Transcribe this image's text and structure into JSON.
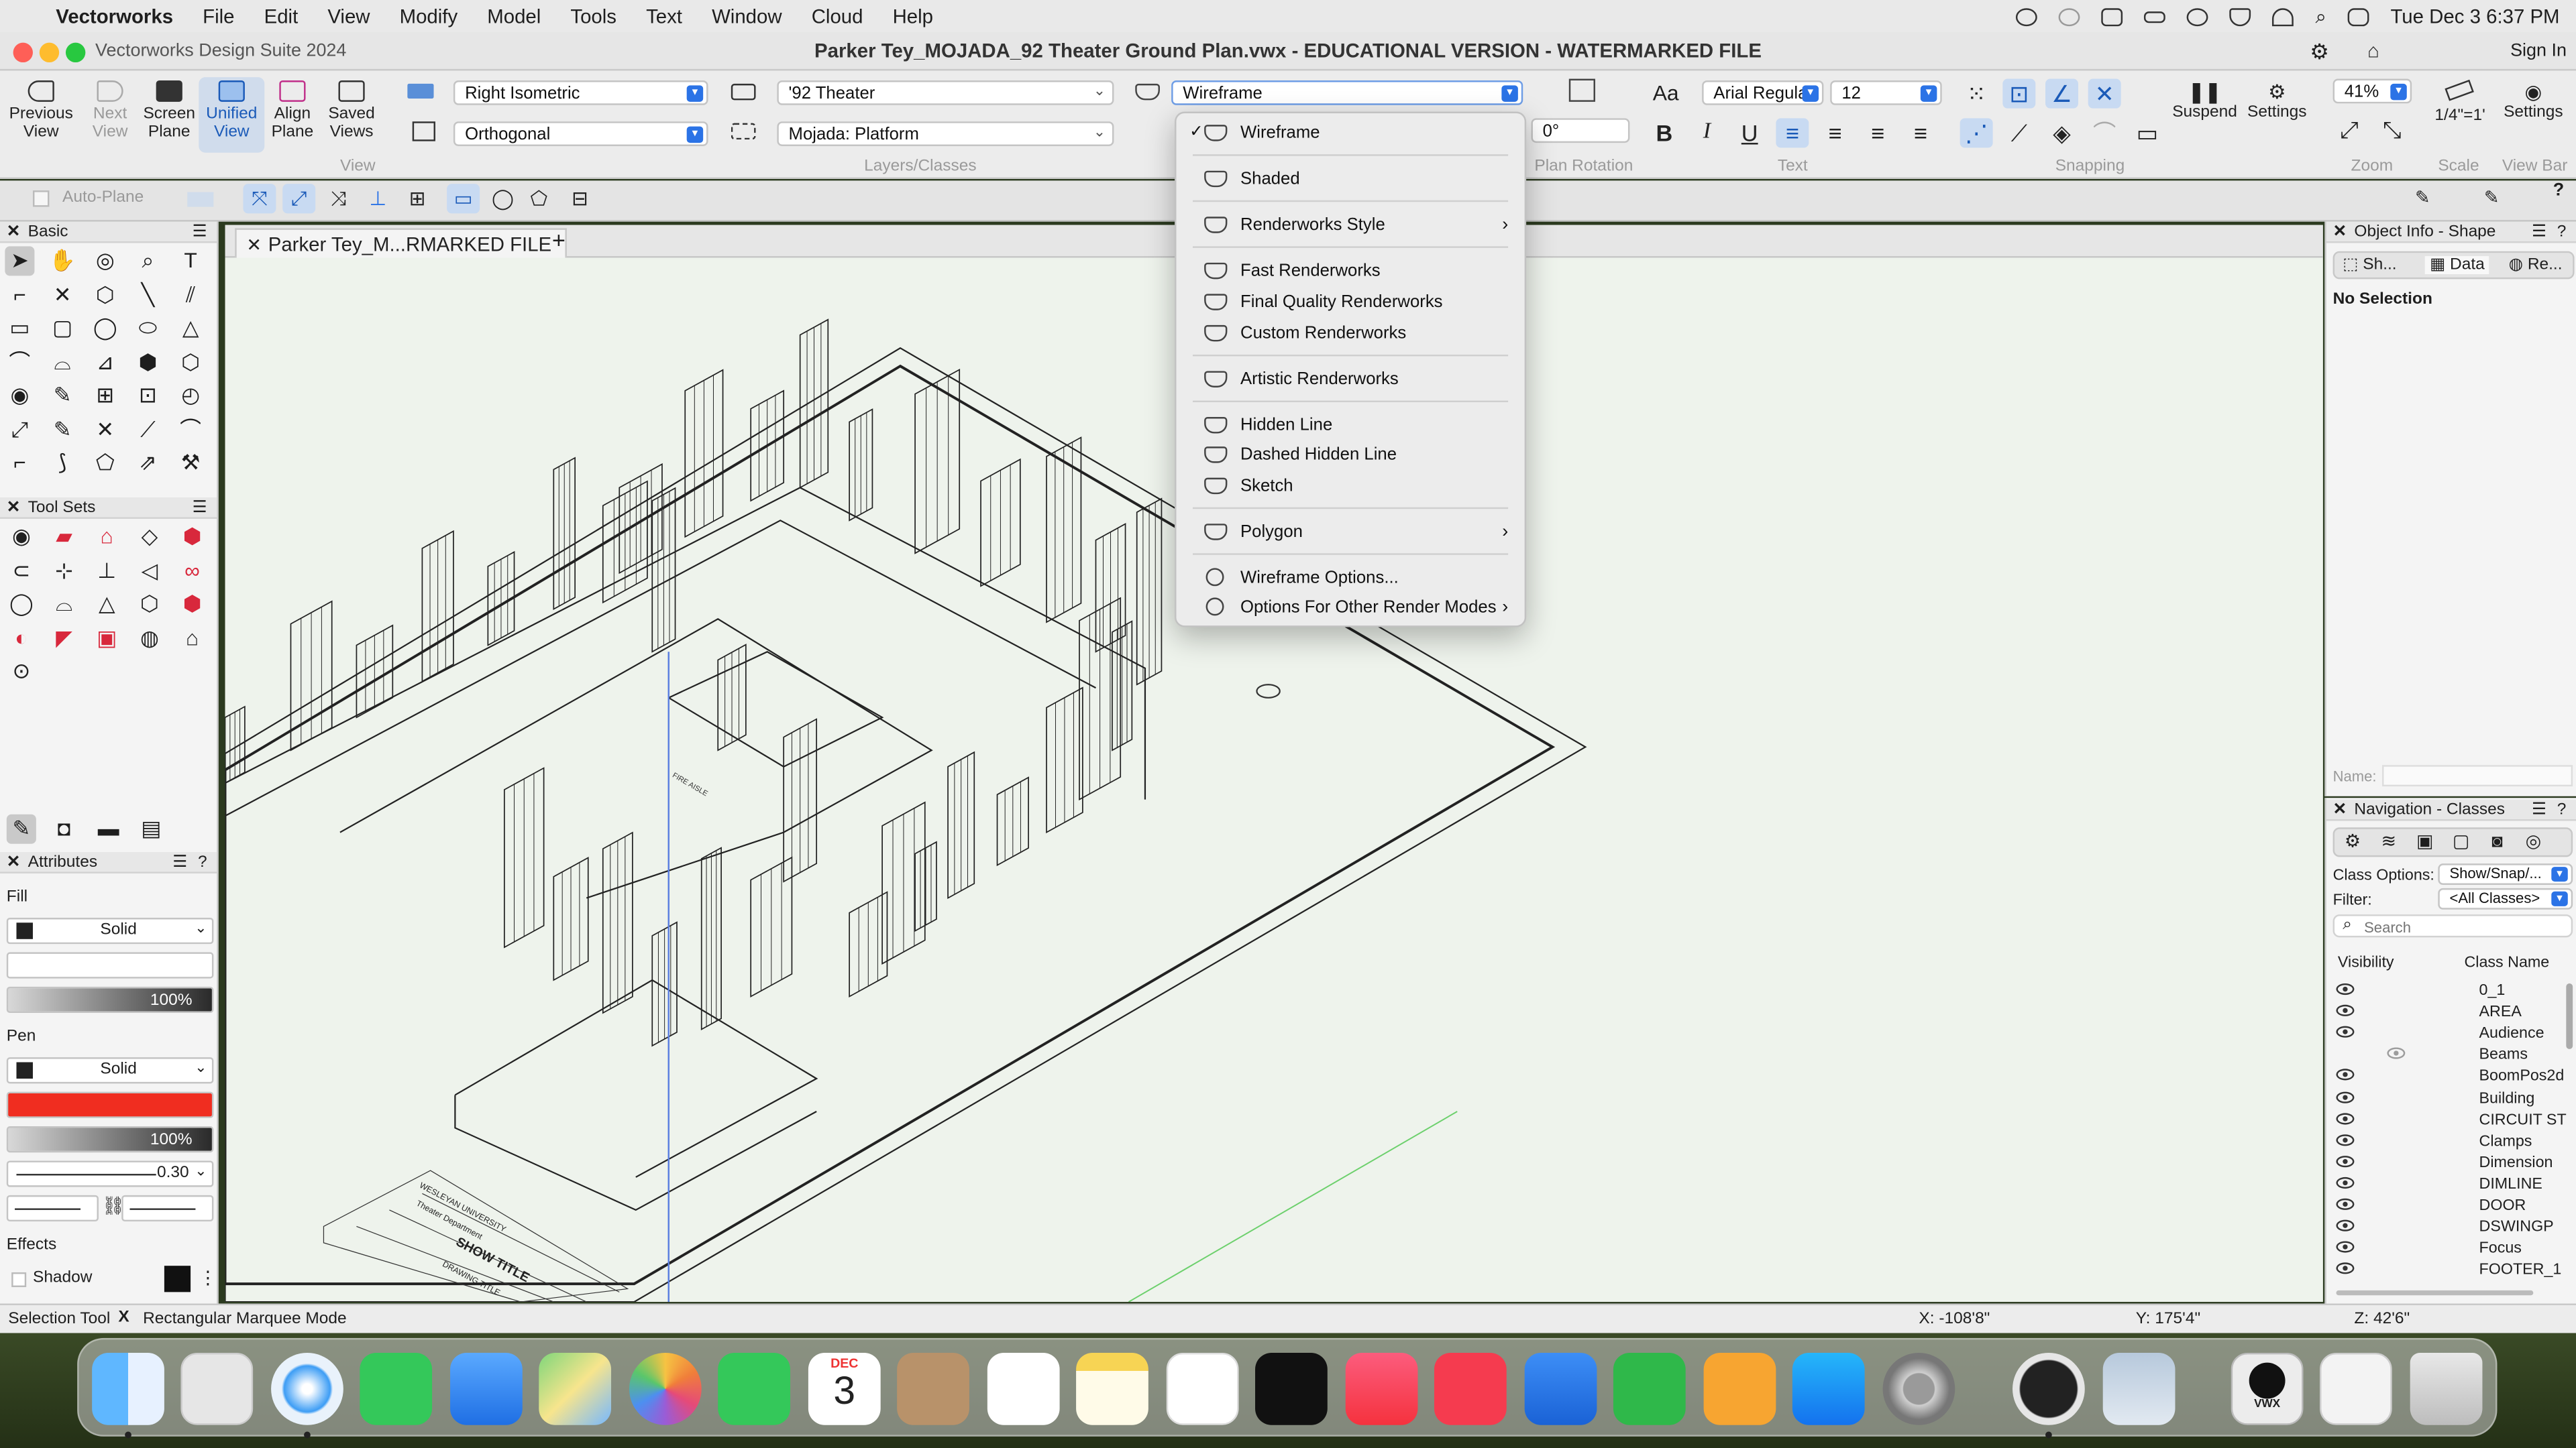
{
  "menubar": {
    "app_name": "Vectorworks",
    "items": [
      "File",
      "Edit",
      "View",
      "Modify",
      "Model",
      "Tools",
      "Text",
      "Window",
      "Cloud",
      "Help"
    ],
    "datetime": "Tue Dec 3  6:37 PM"
  },
  "window": {
    "app_label": "Vectorworks Design Suite 2024",
    "title": "Parker Tey_MOJADA_92 Theater Ground Plan.vwx - EDUCATIONAL VERSION - WATERMARKED FILE",
    "sign_in": "Sign In"
  },
  "viewbar": {
    "previous_view": "Previous View",
    "next_view": "Next View",
    "screen_plane": "Screen Plane",
    "unified_view": "Unified View",
    "align_plane": "Align Plane",
    "saved_views": "Saved Views",
    "view_group": "View",
    "view_type": "Right Isometric",
    "projection": "Orthogonal",
    "layer": "'92 Theater",
    "class": "Mojada: Platform",
    "layers_group": "Layers/Classes",
    "render_mode": "Wireframe",
    "plan_rotation_value": "0°",
    "plan_rotation_label": "Plan Rotation",
    "font": "Arial Regular",
    "font_size": "12",
    "text_group": "Text",
    "snapping_group": "Snapping",
    "suspend": "Suspend",
    "settings": "Settings",
    "zoom_value": "41%",
    "zoom_group": "Zoom",
    "scale_value": "1/4\"=1'",
    "scale_group": "Scale",
    "viewbar_settings": "Settings",
    "viewbar_group": "View Bar"
  },
  "modebar": {
    "auto_plane": "Auto-Plane"
  },
  "basic_palette": {
    "title": "Basic"
  },
  "toolsets_palette": {
    "title": "Tool Sets"
  },
  "attributes": {
    "title": "Attributes",
    "fill_label": "Fill",
    "fill_style": "Solid",
    "fill_opacity": "100%",
    "pen_label": "Pen",
    "pen_style": "Solid",
    "pen_color": "#f02d20",
    "pen_opacity": "100%",
    "line_weight": "0.30",
    "effects_label": "Effects",
    "shadow_label": "Shadow"
  },
  "document_tab": {
    "label": "Parker Tey_M...RMARKED FILE",
    "add": "+"
  },
  "drawing": {
    "title_block_lines": [
      "WESLEYAN UNIVERSITY",
      "Theater Department",
      "SHOW TITLE",
      "DRAWING TITLE"
    ],
    "aisle_label": "FIRE AISLE"
  },
  "render_menu": {
    "items": [
      {
        "label": "Wireframe",
        "checked": true,
        "submenu": false
      },
      {
        "label": "Shaded",
        "checked": false,
        "submenu": false
      },
      {
        "label": "Renderworks Style",
        "checked": false,
        "submenu": true
      },
      {
        "label": "Fast Renderworks",
        "checked": false,
        "submenu": false
      },
      {
        "label": "Final Quality Renderworks",
        "checked": false,
        "submenu": false
      },
      {
        "label": "Custom Renderworks",
        "checked": false,
        "submenu": false
      },
      {
        "label": "Artistic Renderworks",
        "checked": false,
        "submenu": false
      },
      {
        "label": "Hidden Line",
        "checked": false,
        "submenu": false
      },
      {
        "label": "Dashed Hidden Line",
        "checked": false,
        "submenu": false
      },
      {
        "label": "Sketch",
        "checked": false,
        "submenu": false
      },
      {
        "label": "Polygon",
        "checked": false,
        "submenu": true
      },
      {
        "label": "Wireframe Options...",
        "checked": false,
        "submenu": false
      },
      {
        "label": "Options For Other Render Modes",
        "checked": false,
        "submenu": true
      }
    ]
  },
  "object_info": {
    "title": "Object Info - Shape",
    "tabs": [
      "Sh...",
      "Data",
      "Re..."
    ],
    "selection": "No Selection",
    "name_label": "Name:"
  },
  "navigation": {
    "title": "Navigation - Classes",
    "class_options_label": "Class Options:",
    "class_options_value": "Show/Snap/...",
    "filter_label": "Filter:",
    "filter_value": "<All Classes>",
    "search_placeholder": "Search",
    "col_visibility": "Visibility",
    "col_class_name": "Class Name",
    "classes": [
      "0_1",
      "AREA",
      "Audience",
      "Beams",
      "BoomPos2d",
      "Building",
      "CIRCUIT ST",
      "Clamps",
      "Dimension",
      "DIMLINE",
      "DOOR",
      "DSWINGP",
      "Focus",
      "FOOTER_1"
    ]
  },
  "statusbar": {
    "tool": "Selection Tool",
    "mode": "Rectangular Marquee Mode",
    "x": "X: -108'8\"",
    "y": "Y: 175'4\"",
    "z": "Z: 42'6\""
  },
  "dock": {
    "calendar_month": "DEC",
    "calendar_day": "3",
    "vwx_label": "VWX"
  }
}
